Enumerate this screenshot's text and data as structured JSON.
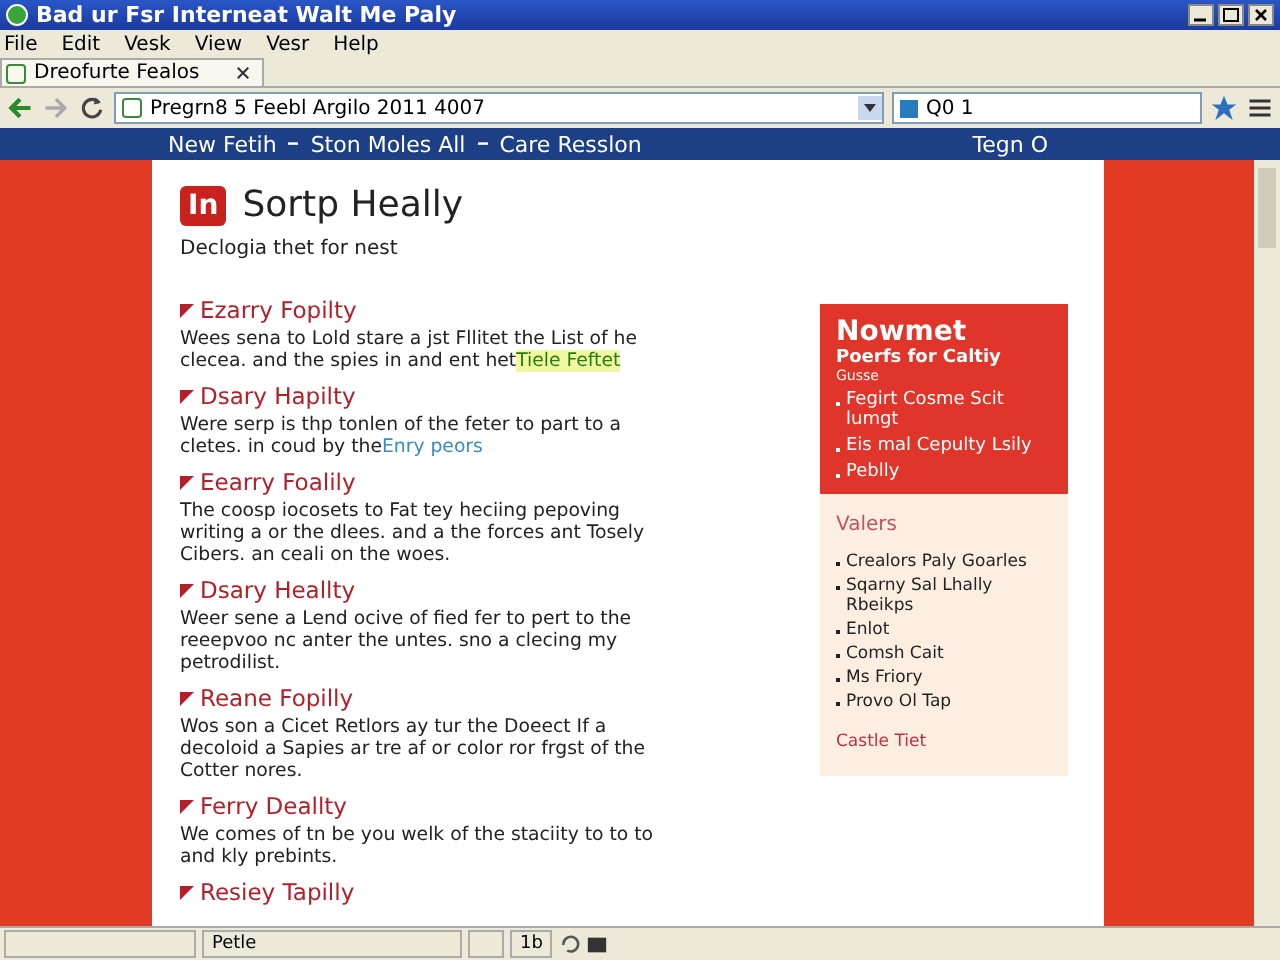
{
  "window": {
    "title": "Bad ur Fsr Interneat Walt Me Paly"
  },
  "menu": [
    "File",
    "Edit",
    "Vesk",
    "View",
    "Vesr",
    "Help"
  ],
  "tabs": [
    {
      "label": "Dreofurte Fealos",
      "selected": true
    }
  ],
  "address": {
    "value": "Pregrn8 5 Feebl Argilo 2011 4007"
  },
  "search": {
    "value": "Q0 1"
  },
  "nav": {
    "links": [
      "New Fetih",
      "Ston Moles All",
      "Care Resslon"
    ],
    "right": "Tegn O"
  },
  "page": {
    "logo": "In",
    "title": "Sortp Heally",
    "subtitle": "Declogia thet for nest",
    "sections": [
      {
        "heading": "Ezarry Fopilty",
        "lines": [
          "Wees sena to Lold stare a jst Fllitet the List of he",
          "clecea. and the spies in and ent het"
        ],
        "link": "Tiele Feftet",
        "link_highlighted": true
      },
      {
        "heading": "Dsary Hapilty",
        "lines": [
          "Were serp is thp tonlen of the feter to part to a",
          "cletes. in coud by the"
        ],
        "link": "Enry peors",
        "link_highlighted": false
      },
      {
        "heading": "Eearry Foalily",
        "lines": [
          "The coosp iocosets to Fat tey heciing pepoving",
          "writing a or the dlees. and a the forces ant Tosely",
          "Cibers. an ceali on the woes."
        ]
      },
      {
        "heading": "Dsary Heallty",
        "lines": [
          "Weer sene a Lend ocive of fied fer to pert to the",
          "reeepvoo nc anter the untes. sno a clecing my",
          "petrodilist."
        ]
      },
      {
        "heading": "Reane Fopilly",
        "lines": [
          "Wos son a Cicet Retlors ay tur the Doeect If a",
          "decoloid a Sapies ar tre af or color ror frgst of the",
          "Cotter nores."
        ]
      },
      {
        "heading": "Ferry Deallty",
        "lines": [
          "We comes of tn be you welk of the staciity to to to",
          "and kly prebints."
        ]
      },
      {
        "heading": "Resiey Tapilly"
      }
    ]
  },
  "sidebar": {
    "title": "Nowmet",
    "subtitle": "Poerfs for Caltiy",
    "note": "Gusse",
    "items": [
      "Fegirt Cosme Scit lumgt",
      "Eis mal Cepulty Lsily",
      "Peblly"
    ],
    "section_title": "Valers",
    "values": [
      "Crealors Paly Goarles",
      "Sqarny Sal Lhally Rbeikps",
      "Enlot",
      "Comsh Cait",
      "Ms Friory",
      "Provo Ol Tap"
    ],
    "link": "Castle Tiet"
  },
  "status_bar": {
    "cells": [
      "Petle",
      "1b"
    ]
  }
}
